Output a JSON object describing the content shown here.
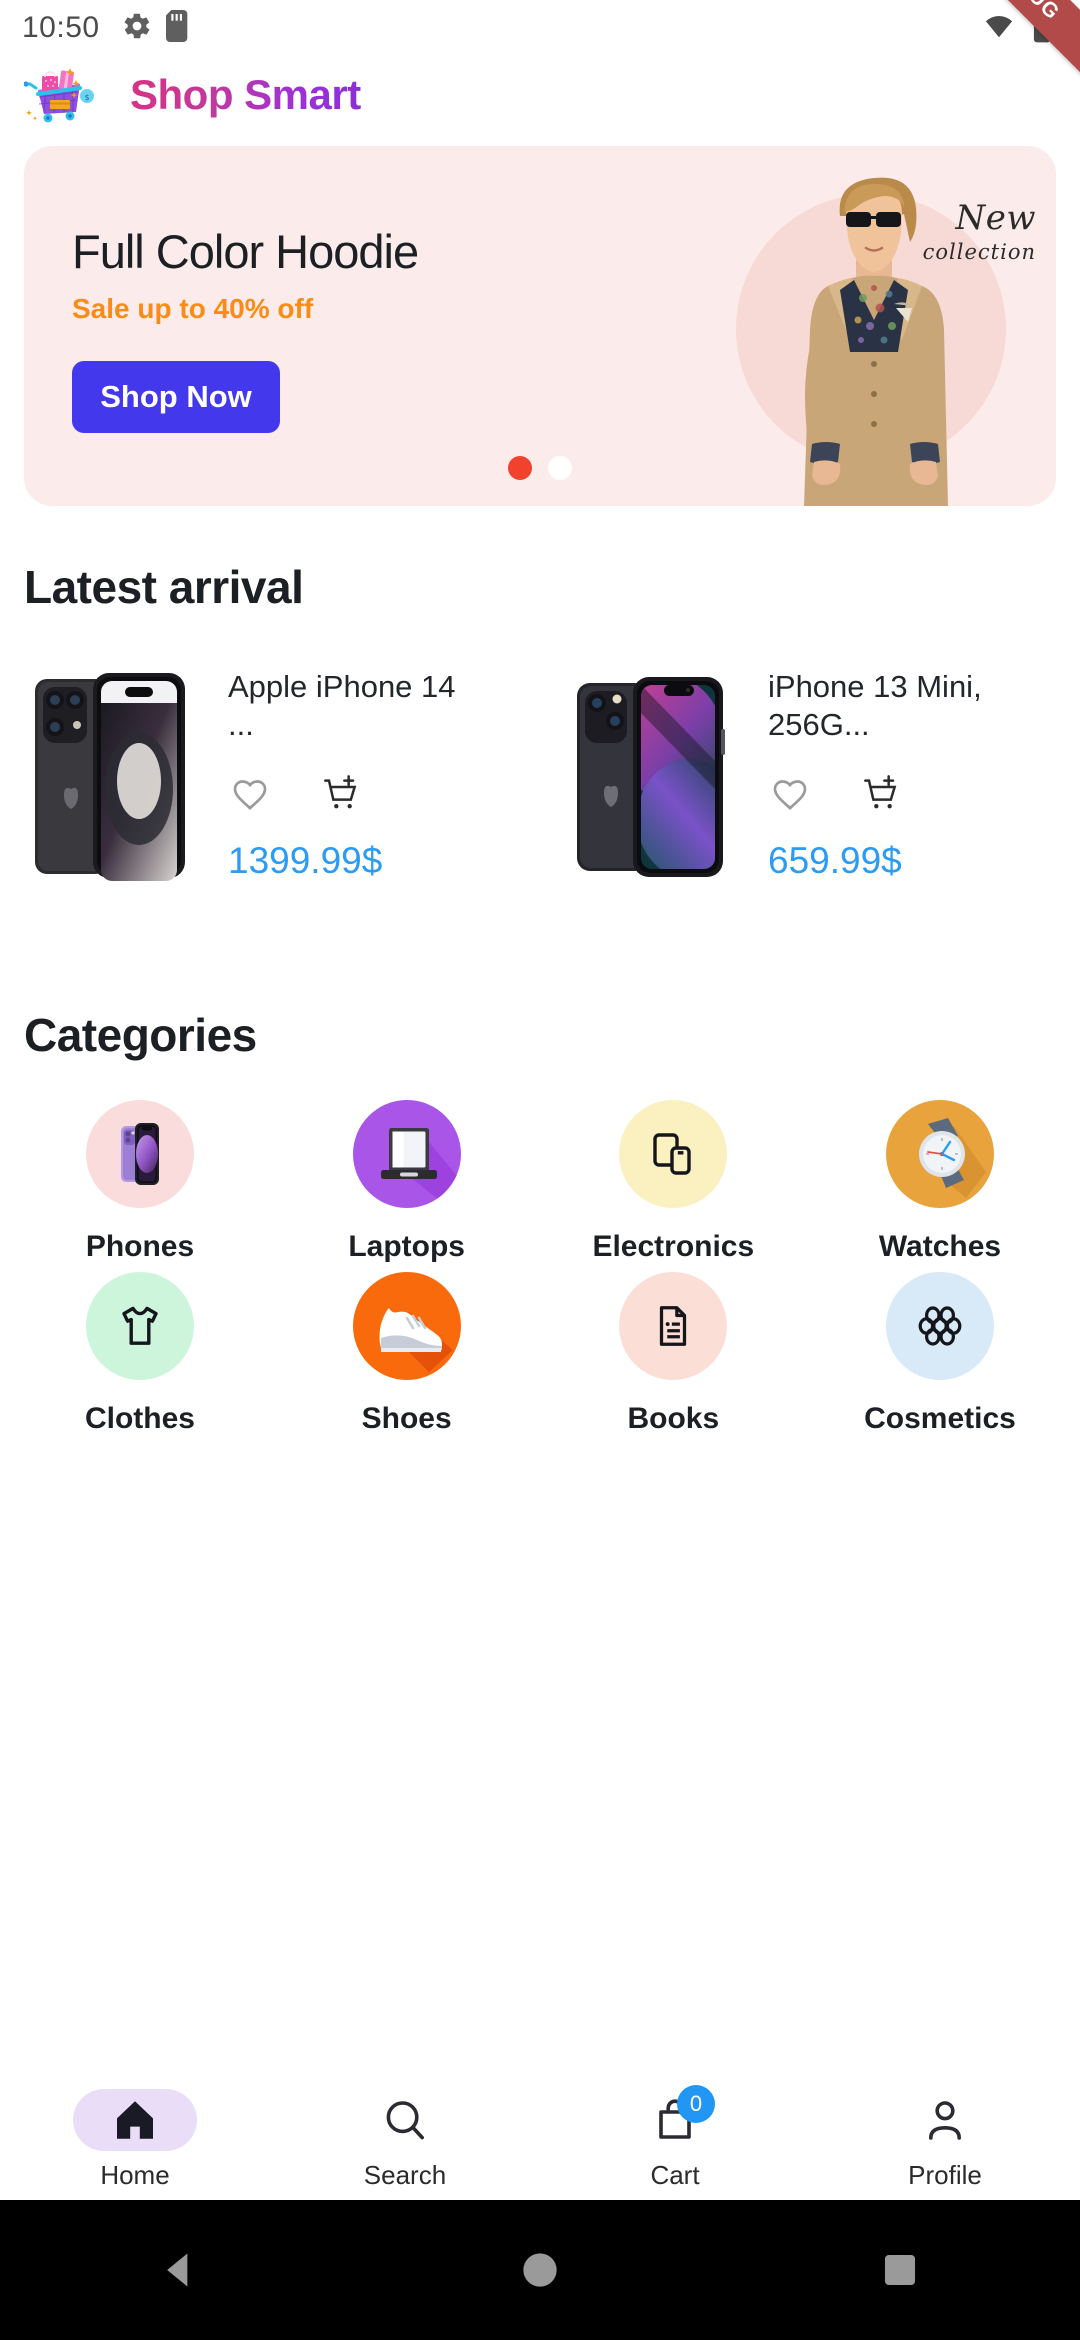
{
  "status_bar": {
    "time": "10:50",
    "left_icons": [
      "gear-icon",
      "sd-card-icon"
    ],
    "right_icons": [
      "wifi-icon",
      "battery-icon"
    ],
    "debug_ribbon": "DEBUG"
  },
  "header": {
    "logo_icon": "shopping-cart-emoji",
    "title": "Shop Smart",
    "title_gradient_from": "#d63384",
    "title_gradient_to": "#8b2fd6"
  },
  "banner": {
    "title": "Full Color Hoodie",
    "subtitle": "Sale up to 40% off",
    "cta_label": "Shop Now",
    "cta_color": "#4338ec",
    "background": "#fbeceb",
    "overlay_line1": "New",
    "overlay_line2": "collection",
    "active_dot_color": "#f2422e",
    "inactive_dot_color": "#ffffff",
    "dot_count": 2,
    "active_dot_index": 0
  },
  "latest_arrival": {
    "heading": "Latest arrival",
    "products": [
      {
        "name": "Apple iPhone 14 ...",
        "price": "1399.99$",
        "price_color": "#2b9bf4",
        "favorite_icon": "heart-icon",
        "cart_icon": "add-to-cart-icon",
        "image": "iphone-14-pro-black"
      },
      {
        "name": "iPhone 13 Mini, 256G...",
        "price": "659.99$",
        "price_color": "#2b9bf4",
        "favorite_icon": "heart-icon",
        "cart_icon": "add-to-cart-icon",
        "image": "iphone-13-mini-midnight"
      }
    ]
  },
  "categories": {
    "heading": "Categories",
    "items": [
      {
        "label": "Phones",
        "icon": "phone-icon",
        "bg": "#fadcdc"
      },
      {
        "label": "Laptops",
        "icon": "laptop-icon",
        "bg": "#a855e8"
      },
      {
        "label": "Electronics",
        "icon": "devices-icon",
        "bg": "#fbf0c0"
      },
      {
        "label": "Watches",
        "icon": "watch-icon",
        "bg": "#e8a33c"
      },
      {
        "label": "Clothes",
        "icon": "tshirt-icon",
        "bg": "#cdf5dc"
      },
      {
        "label": "Shoes",
        "icon": "sneaker-icon",
        "bg": "#f96a0c"
      },
      {
        "label": "Books",
        "icon": "document-icon",
        "bg": "#fbdfd6"
      },
      {
        "label": "Cosmetics",
        "icon": "flower-icon",
        "bg": "#d8e9f7"
      }
    ]
  },
  "bottom_nav": {
    "items": [
      {
        "label": "Home",
        "icon": "home-icon",
        "active": true,
        "badge": null
      },
      {
        "label": "Search",
        "icon": "search-icon",
        "active": false,
        "badge": null
      },
      {
        "label": "Cart",
        "icon": "cart-icon",
        "active": false,
        "badge": "0"
      },
      {
        "label": "Profile",
        "icon": "person-icon",
        "active": false,
        "badge": null
      }
    ],
    "badge_color": "#2196f3",
    "active_pill_color": "#e9ddf8"
  },
  "android_nav": {
    "back": "back-triangle-icon",
    "home": "home-circle-icon",
    "recents": "recents-square-icon"
  }
}
